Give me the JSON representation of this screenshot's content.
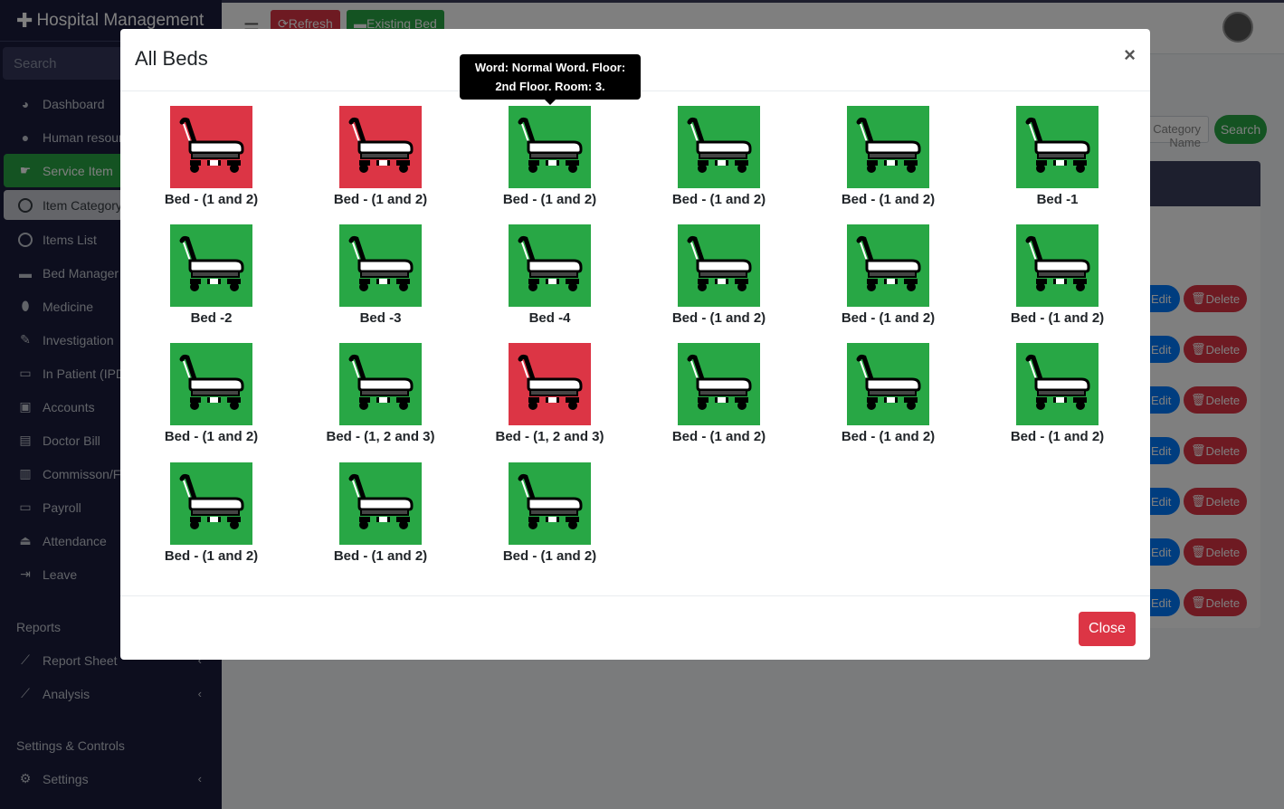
{
  "sidebar": {
    "brand": "Hospital Management",
    "search_placeholder": "Search",
    "items": [
      {
        "label": "Dashboard",
        "icon": "dashboard-icon"
      },
      {
        "label": "Human resource",
        "icon": "user-icon"
      },
      {
        "label": "Service Item",
        "icon": "hand-icon"
      },
      {
        "label": "Item Category",
        "icon": "circle-icon"
      },
      {
        "label": "Items List",
        "icon": "circle-icon"
      },
      {
        "label": "Bed Manager",
        "icon": "bed-icon"
      },
      {
        "label": "Medicine",
        "icon": "pills-icon"
      },
      {
        "label": "Investigation",
        "icon": "syringe-icon"
      },
      {
        "label": "In Patient (IPD)",
        "icon": "procedures-icon"
      },
      {
        "label": "Accounts",
        "icon": "money-icon"
      },
      {
        "label": "Doctor Bill",
        "icon": "wallet-icon"
      },
      {
        "label": "Commisson/Fee",
        "icon": "card-icon"
      },
      {
        "label": "Payroll",
        "icon": "card-icon"
      },
      {
        "label": "Attendance",
        "icon": "bell-icon"
      },
      {
        "label": "Leave",
        "icon": "sign-out-icon"
      }
    ],
    "reports_header": "Reports",
    "report_items": [
      {
        "label": "Report Sheet"
      },
      {
        "label": "Analysis"
      }
    ],
    "settings_header": "Settings & Controls",
    "settings_item": "Settings"
  },
  "topbar": {
    "refresh": "Refresh",
    "existing_bed": "Existing Bed"
  },
  "page": {
    "search_placeholder": "Category Name",
    "search_button": "Search",
    "edit": "Edit",
    "delete": "Delete"
  },
  "modal": {
    "title": "All Beds",
    "close_x": "×",
    "close_button": "Close",
    "tooltip": "Word: Normal Word. Floor: 2nd Floor. Room: 3.",
    "beds": [
      {
        "label": "Bed - (1 and 2)",
        "status": "occupied"
      },
      {
        "label": "Bed - (1 and 2)",
        "status": "occupied"
      },
      {
        "label": "Bed - (1 and 2)",
        "status": "available"
      },
      {
        "label": "Bed - (1 and 2)",
        "status": "available"
      },
      {
        "label": "Bed - (1 and 2)",
        "status": "available"
      },
      {
        "label": "Bed -1",
        "status": "available"
      },
      {
        "label": "Bed -2",
        "status": "available"
      },
      {
        "label": "Bed -3",
        "status": "available"
      },
      {
        "label": "Bed -4",
        "status": "available"
      },
      {
        "label": "Bed - (1 and 2)",
        "status": "available"
      },
      {
        "label": "Bed - (1 and 2)",
        "status": "available"
      },
      {
        "label": "Bed - (1 and 2)",
        "status": "available"
      },
      {
        "label": "Bed - (1 and 2)",
        "status": "available"
      },
      {
        "label": "Bed - (1, 2 and 3)",
        "status": "available"
      },
      {
        "label": "Bed - (1, 2 and 3)",
        "status": "occupied"
      },
      {
        "label": "Bed - (1 and 2)",
        "status": "available"
      },
      {
        "label": "Bed - (1 and 2)",
        "status": "available"
      },
      {
        "label": "Bed - (1 and 2)",
        "status": "available"
      },
      {
        "label": "Bed - (1 and 2)",
        "status": "available"
      },
      {
        "label": "Bed - (1 and 2)",
        "status": "available"
      },
      {
        "label": "Bed - (1 and 2)",
        "status": "available"
      }
    ]
  },
  "colors": {
    "available": "#28a745",
    "occupied": "#dc3545",
    "sidebar_bg": "#1a1c3d"
  }
}
